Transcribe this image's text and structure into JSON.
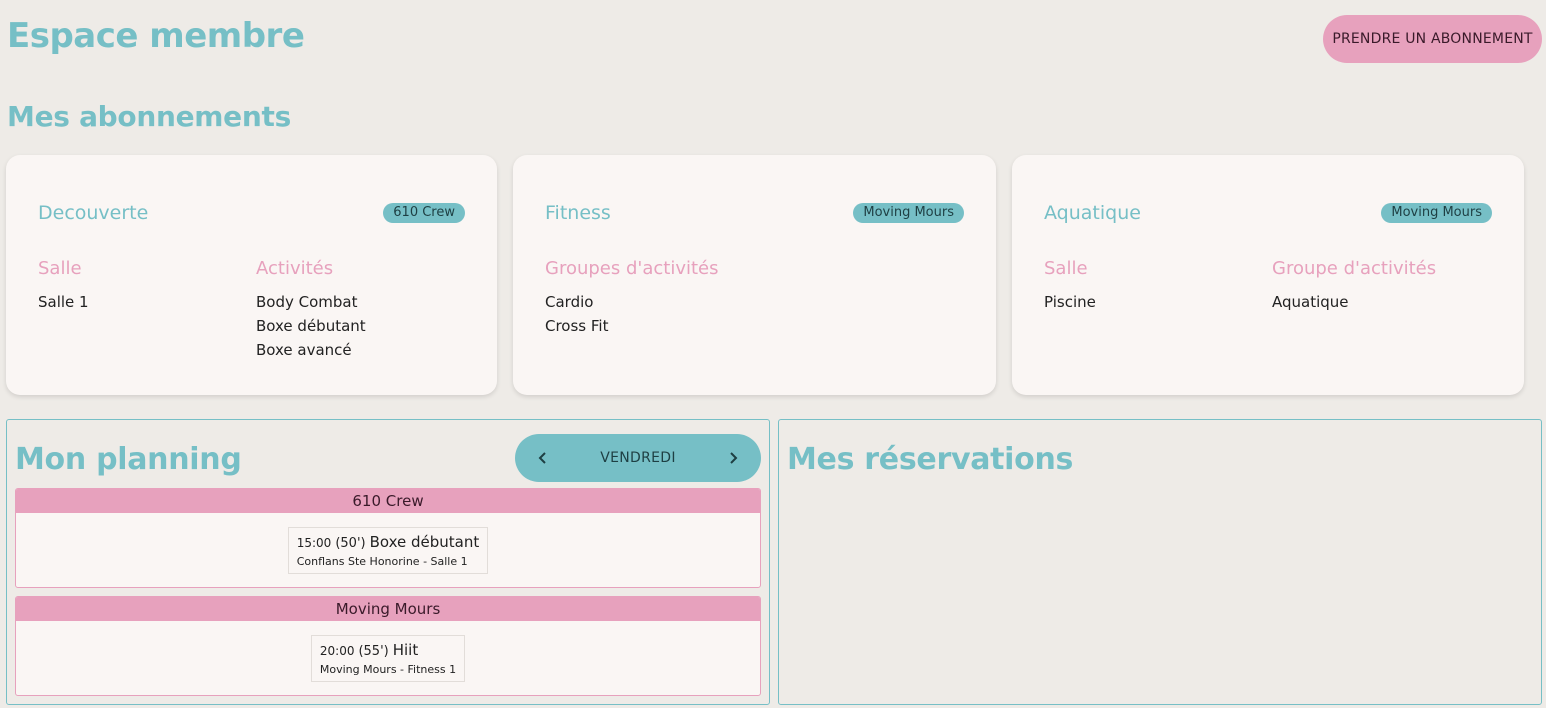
{
  "page": {
    "title": "Espace membre",
    "subscribe_label": "PRENDRE UN ABONNEMENT"
  },
  "subscriptions": {
    "title": "Mes abonnements",
    "cards": [
      {
        "name": "Decouverte",
        "club": "610 Crew",
        "columns": [
          {
            "header": "Salle",
            "items": [
              "Salle 1"
            ]
          },
          {
            "header": "Activités",
            "items": [
              "Body Combat",
              "Boxe débutant",
              "Boxe avancé"
            ]
          }
        ]
      },
      {
        "name": "Fitness",
        "club": "Moving Mours",
        "columns": [
          {
            "header": "Groupes d'activités",
            "items": [
              "Cardio",
              "Cross Fit"
            ]
          }
        ]
      },
      {
        "name": "Aquatique",
        "club": "Moving Mours",
        "columns": [
          {
            "header": "Salle",
            "items": [
              "Piscine"
            ]
          },
          {
            "header": "Groupe d'activités",
            "items": [
              "Aquatique"
            ]
          }
        ]
      }
    ]
  },
  "planning": {
    "title": "Mon planning",
    "day": "VENDREDI",
    "prev_icon": "chevron-left-icon",
    "next_icon": "chevron-right-icon",
    "clubs": [
      {
        "name": "610 Crew",
        "sessions": [
          {
            "time": "15:00",
            "duration": "(50')",
            "activity": "Boxe débutant",
            "location": "Conflans Ste Honorine - Salle 1"
          }
        ]
      },
      {
        "name": "Moving Mours",
        "sessions": [
          {
            "time": "20:00",
            "duration": "(55')",
            "activity": "Hiit",
            "location": "Moving Mours - Fitness 1"
          }
        ]
      }
    ]
  },
  "reservations": {
    "title": "Mes réservations"
  },
  "colors": {
    "accent_teal": "#76bfc6",
    "accent_pink": "#e7a1bd",
    "background": "#eeebe7",
    "card": "#faf6f4"
  }
}
